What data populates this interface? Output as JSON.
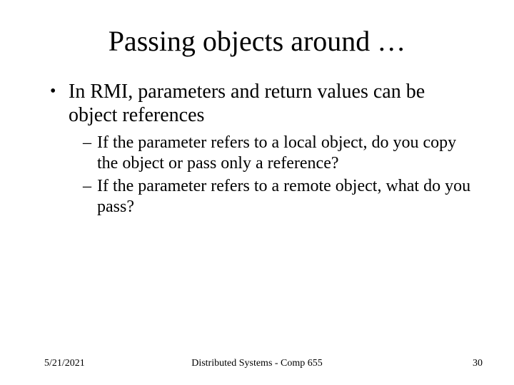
{
  "title": "Passing objects around …",
  "bullets": [
    {
      "text": "In RMI, parameters and return values can be object references",
      "sub": [
        "If the parameter refers to a local object, do you copy the object or pass only a reference?",
        "If the parameter refers to a remote object, what do you pass?"
      ]
    }
  ],
  "footer": {
    "date": "5/21/2021",
    "center": "Distributed Systems - Comp 655",
    "page": "30"
  }
}
